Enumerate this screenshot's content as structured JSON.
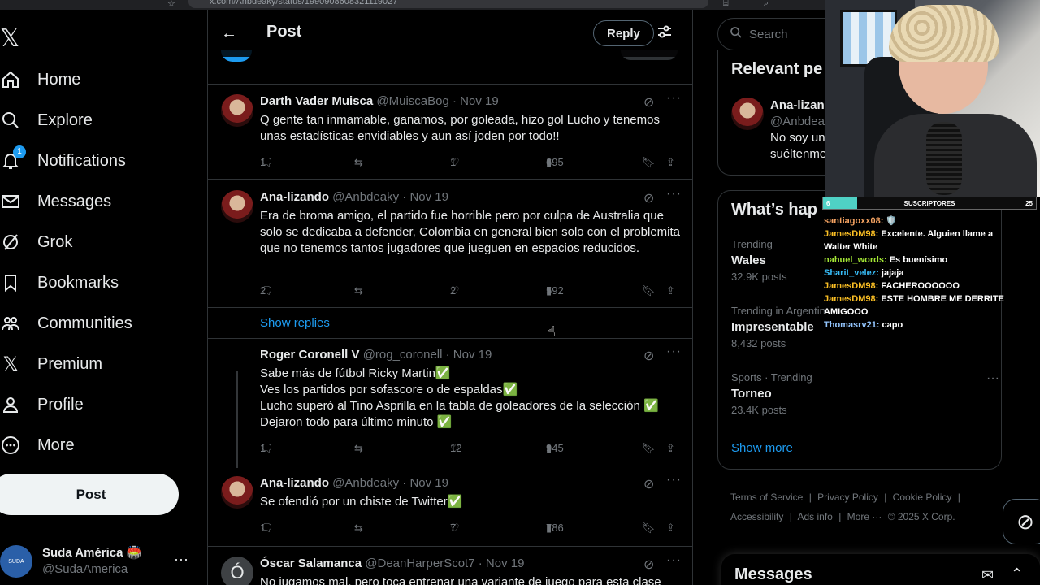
{
  "browser": {
    "url": "x.com/Anbdeaky/status/1990908608321119027"
  },
  "nav": {
    "items": [
      {
        "label": "Home",
        "icon": "home-icon"
      },
      {
        "label": "Explore",
        "icon": "search-icon"
      },
      {
        "label": "Notifications",
        "icon": "bell-icon",
        "badge": "1"
      },
      {
        "label": "Messages",
        "icon": "mail-icon"
      },
      {
        "label": "Grok",
        "icon": "grok-icon"
      },
      {
        "label": "Bookmarks",
        "icon": "bookmark-icon"
      },
      {
        "label": "Communities",
        "icon": "people-icon"
      },
      {
        "label": "Premium",
        "icon": "x-icon"
      },
      {
        "label": "Profile",
        "icon": "person-icon"
      },
      {
        "label": "More",
        "icon": "more-circle-icon"
      }
    ],
    "post_button": "Post",
    "account": {
      "display_name": "Suda América 🏟️",
      "handle": "@SudaAmerica"
    }
  },
  "header": {
    "title": "Post",
    "reply_button": "Reply"
  },
  "tweets": [
    {
      "name": "Darth Vader Muisca",
      "handle": "@MuiscaBog · Nov 19",
      "text": [
        "Q gente tan inmamable, ganamos, por goleada, hizo gol Lucho y tenemos unas estadísticas envidiables y aun así joden por todo!!"
      ],
      "replies": "1",
      "retweets": "",
      "likes": "1",
      "views": "695"
    },
    {
      "name": "Ana-lizando",
      "handle": "@Anbdeaky · Nov 19",
      "text": [
        "Era de broma amigo, el partido fue horrible pero por culpa de Australia que solo se dedicaba a defender, Colombia en general bien solo con el problemita que no tenemos tantos jugadores que jueguen en espacios reducidos."
      ],
      "replies": "2",
      "retweets": "",
      "likes": "2",
      "views": "592"
    },
    {
      "name": "Roger Coronell V",
      "handle": "@rog_coronell · Nov 19",
      "text": [
        "Sabe más de fútbol Ricky Martin✅",
        "Ves los partidos por sofascore o de espaldas✅",
        "Lucho superó al Tino Asprilla en la tabla de goleadores de la selección ✅",
        "Dejaron todo para último minuto ✅"
      ],
      "replies": "1",
      "retweets": "",
      "likes": "12",
      "views": "945"
    },
    {
      "name": "Ana-lizando",
      "handle": "@Anbdeaky · Nov 19",
      "text": [
        "Se ofendió por un chiste de Twitter✅"
      ],
      "replies": "1",
      "retweets": "",
      "likes": "7",
      "views": "786"
    },
    {
      "name": "Óscar Salamanca",
      "handle": "@DeanHarperScot7 · Nov 19",
      "text": [
        "No jugamos mal, pero toca entrenar una variante de juego para esta clase"
      ],
      "replies": "",
      "retweets": "",
      "likes": "",
      "views": ""
    }
  ],
  "show_replies": "Show replies",
  "right": {
    "search_placeholder": "Search",
    "relevant_title": "Relevant pe",
    "relevant_name": "Ana-lizan",
    "relevant_handle": "@Anbdeak",
    "relevant_bio_1": "No soy un",
    "relevant_bio_2": "suéltenme",
    "happening_title": "What’s hap",
    "trends": [
      {
        "meta": "Trending",
        "name": "Wales",
        "count": "32.9K posts"
      },
      {
        "meta": "Trending in Argentin",
        "name": "Impresentable",
        "count": "8,432 posts"
      },
      {
        "meta": "Sports · Trending",
        "name": "Torneo",
        "count": "23.4K posts"
      }
    ],
    "show_more": "Show more",
    "footer": [
      "Terms of Service",
      "|",
      "Privacy Policy",
      "|",
      "Cookie Policy",
      "|",
      "Accessibility",
      "|",
      "Ads info",
      "|",
      "More ···",
      "© 2025 X Corp."
    ],
    "messages_title": "Messages"
  },
  "stream": {
    "sub_left": "6",
    "sub_label": "SUSCRIPTORES",
    "sub_right": "25",
    "sub_progress": 0.16,
    "chat": [
      {
        "user": "santiagoxx08:",
        "msg": "🛡️",
        "color": "u"
      },
      {
        "user": "JamesDM98:",
        "msg": "Excelente. Alguien llame a Walter White",
        "color": "u y"
      },
      {
        "user": "nahuel_words:",
        "msg": "Es buenísimo",
        "color": "u g"
      },
      {
        "user": "Sharit_velez:",
        "msg": "jajaja",
        "color": "u b"
      },
      {
        "user": "JamesDM98:",
        "msg": "FACHEROOOOOO",
        "color": "u y"
      },
      {
        "user": "JamesDM98:",
        "msg": "ESTE HOMBRE ME DERRITE AMIGOOO",
        "color": "u y"
      },
      {
        "user": "Thomasrv21:",
        "msg": "capo",
        "color": "u p"
      }
    ]
  }
}
